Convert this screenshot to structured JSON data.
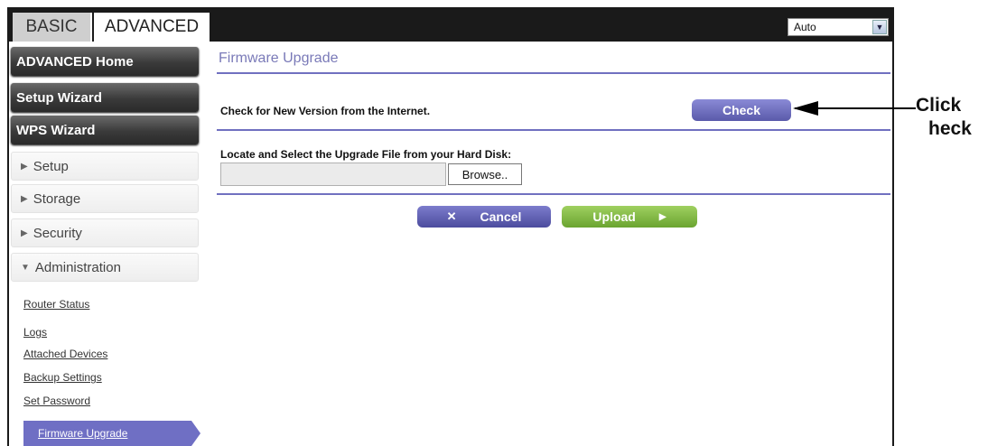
{
  "tabs": {
    "basic": "BASIC",
    "advanced": "ADVANCED"
  },
  "language_select": {
    "value": "Auto"
  },
  "sidebar": {
    "advanced_home": "ADVANCED Home",
    "setup_wizard": "Setup Wizard",
    "wps_wizard": "WPS Wizard",
    "setup": "Setup",
    "storage": "Storage",
    "security": "Security",
    "administration": "Administration",
    "admin_items": [
      "Router Status",
      "Logs",
      "Attached Devices",
      "Backup Settings",
      "Set Password",
      "Firmware Upgrade"
    ]
  },
  "main": {
    "title": "Firmware Upgrade",
    "check_label": "Check for New Version from the Internet.",
    "check_button": "Check",
    "locate_label": "Locate and Select the Upgrade File from your Hard Disk:",
    "file_value": "",
    "browse_button": "Browse..",
    "cancel_button": "Cancel",
    "upload_button": "Upload"
  },
  "callout": {
    "line1": "Click",
    "line2": "heck"
  },
  "colors": {
    "accent": "#6f6fc4",
    "upload": "#7ab840",
    "topbar": "#1a1a1a"
  }
}
